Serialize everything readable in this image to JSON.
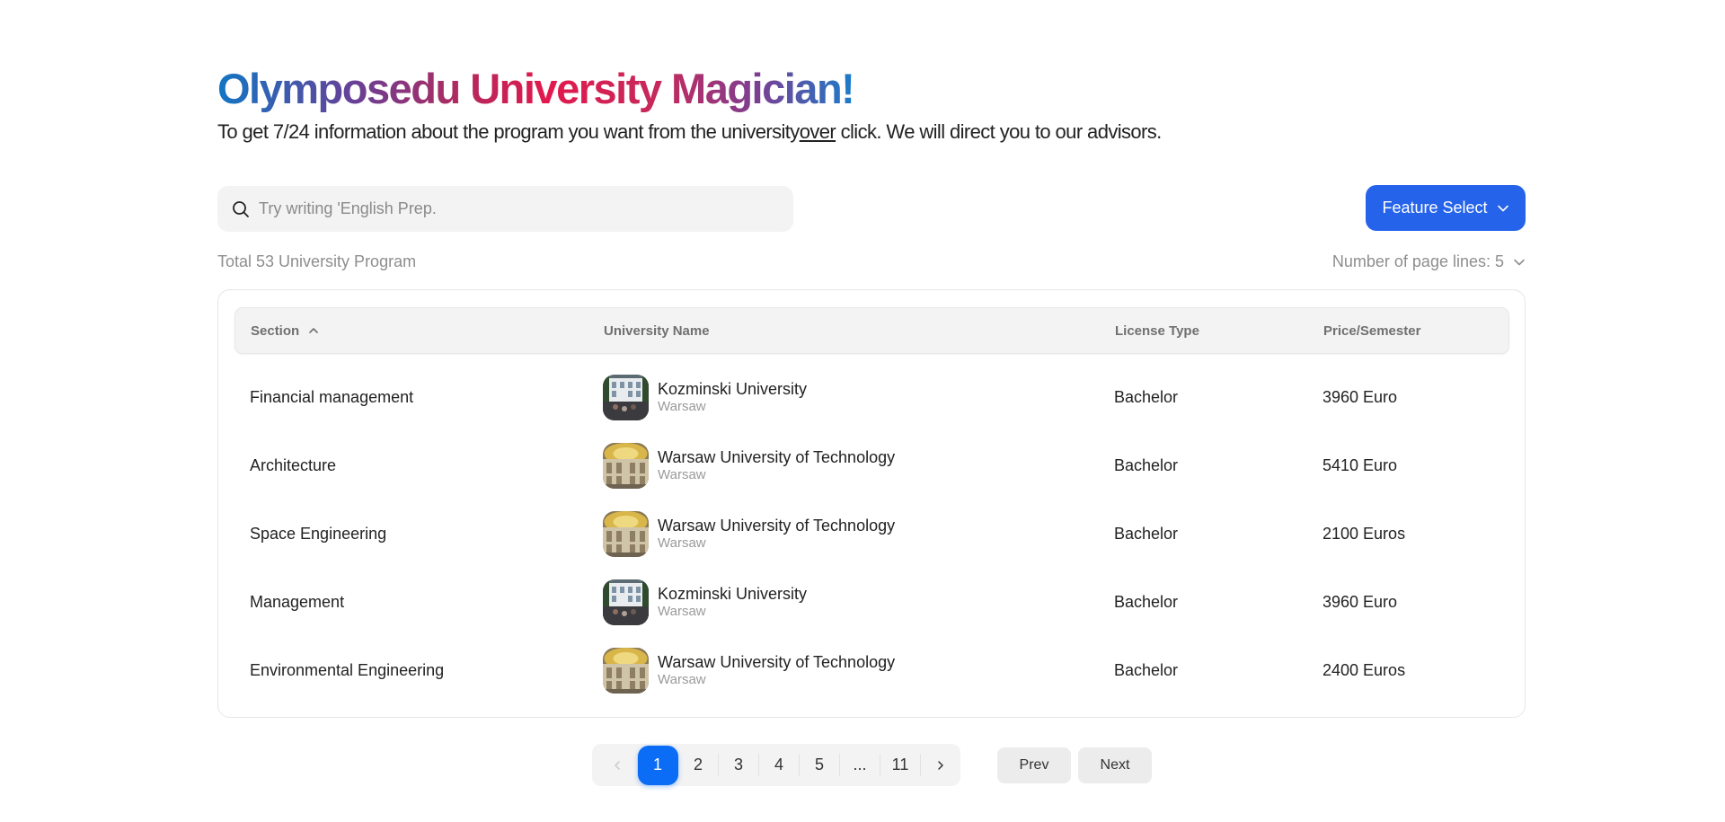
{
  "header": {
    "title": "Olymposedu University Magician!",
    "subtitle_before": "To get 7/24 information about the program you want from the university",
    "subtitle_link": "over",
    "subtitle_after": " click. We will direct you to our advisors."
  },
  "search": {
    "placeholder": "Try writing 'English Prep.",
    "value": ""
  },
  "feature_select": {
    "label": "Feature Select"
  },
  "summary": {
    "total_text": "Total 53 University Program",
    "page_lines_text": "Number of page lines: 5"
  },
  "table": {
    "columns": {
      "section": "Section",
      "university": "University Name",
      "license": "License Type",
      "price": "Price/Semester"
    },
    "rows": [
      {
        "section": "Financial management",
        "university": "Kozminski University",
        "city": "Warsaw",
        "license": "Bachelor",
        "price": "3960 Euro",
        "image": "kozminski"
      },
      {
        "section": "Architecture",
        "university": "Warsaw University of Technology",
        "city": "Warsaw",
        "license": "Bachelor",
        "price": "5410 Euro",
        "image": "wut"
      },
      {
        "section": "Space Engineering",
        "university": "Warsaw University of Technology",
        "city": "Warsaw",
        "license": "Bachelor",
        "price": "2100 Euros",
        "image": "wut"
      },
      {
        "section": "Management",
        "university": "Kozminski University",
        "city": "Warsaw",
        "license": "Bachelor",
        "price": "3960 Euro",
        "image": "kozminski"
      },
      {
        "section": "Environmental Engineering",
        "university": "Warsaw University of Technology",
        "city": "Warsaw",
        "license": "Bachelor",
        "price": "2400 Euros",
        "image": "wut"
      }
    ]
  },
  "pagination": {
    "pages": [
      "1",
      "2",
      "3",
      "4",
      "5",
      "...",
      "11"
    ],
    "current": "1",
    "prev_label": "Prev",
    "next_label": "Next"
  },
  "colors": {
    "primary": "#2563eb",
    "active_page": "#0b6cf5",
    "muted_text": "#8e8e8e"
  },
  "icons": [
    "search-icon",
    "chevron-down-icon",
    "chevron-up-icon",
    "chevron-left-icon",
    "chevron-right-icon"
  ]
}
